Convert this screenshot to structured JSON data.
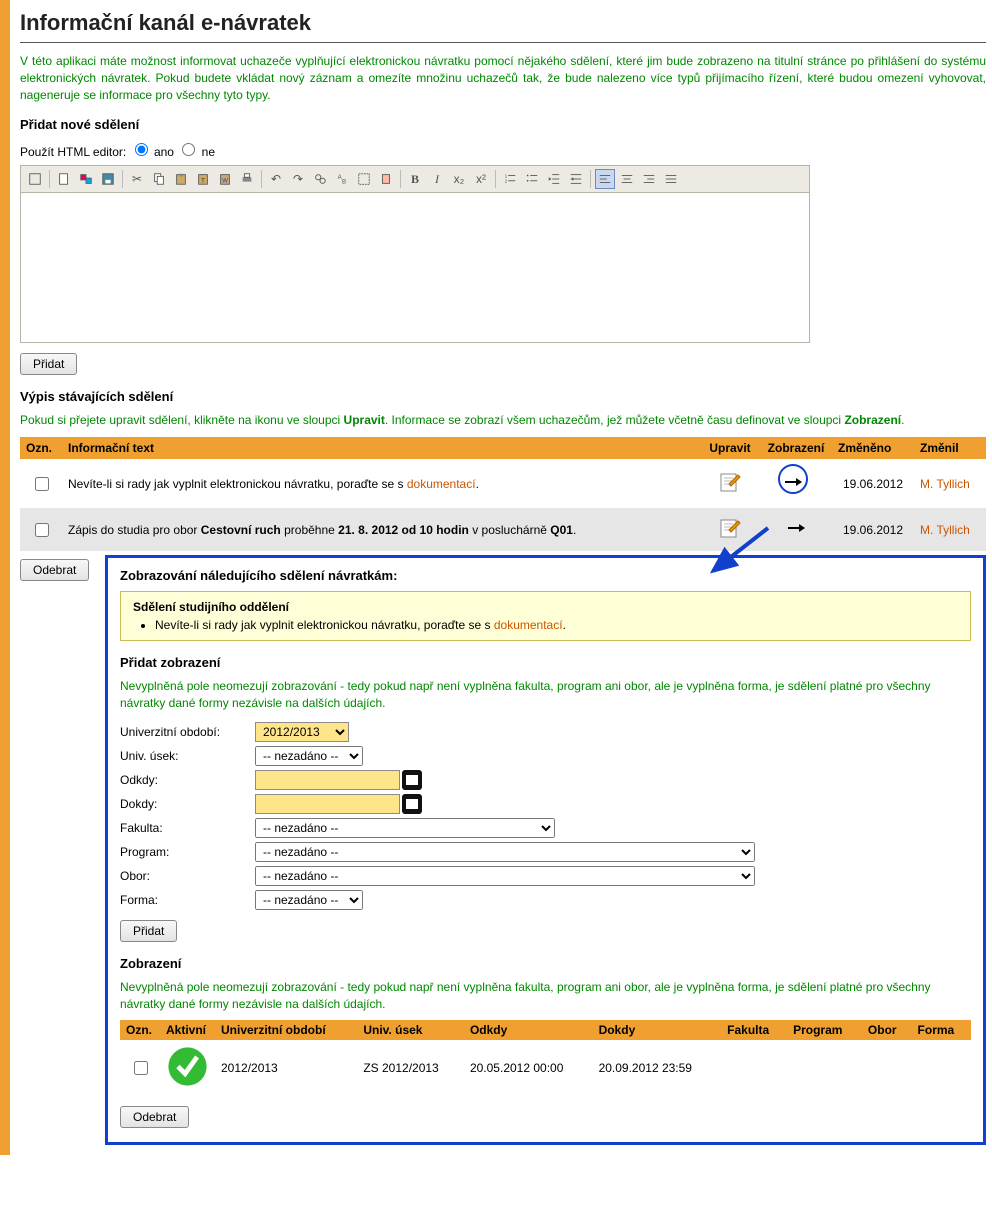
{
  "title": "Informační kanál e-návratek",
  "intro": "V této aplikaci máte možnost informovat uchazeče vyplňující elektronickou návratku pomocí nějakého sdělení, které jim bude zobrazeno na titulní stránce po přihlášení do systému elektronických návratek. Pokud budete vkládat nový záznam a omezíte množinu uchazečů tak, že bude nalezeno více typů přijímacího řízení, které budou omezení vyhovovat, nageneruje se informace pro všechny tyto typy.",
  "add_section_title": "Přidat nové sdělení",
  "editor_label": "Použít HTML editor:",
  "editor_yes": "ano",
  "editor_no": "ne",
  "add_button": "Přidat",
  "list_section_title": "Výpis stávajících sdělení",
  "list_intro_1": "Pokud si přejete upravit sdělení, klikněte na ikonu ve sloupci ",
  "list_intro_bold1": "Upravit",
  "list_intro_2": ". Informace se zobrazí všem uchazečům, jež můžete včetně času definovat ve sloupci ",
  "list_intro_bold2": "Zobrazení",
  "list_intro_3": ".",
  "cols": {
    "ozn": "Ozn.",
    "text": "Informační text",
    "edit": "Upravit",
    "view": "Zobrazení",
    "changed": "Změněno",
    "by": "Změnil"
  },
  "rows": [
    {
      "text_prefix": "Nevíte-li si rady jak vyplnit elektronickou návratku, poraďte se s ",
      "text_link": "dokumentací",
      "text_suffix": ".",
      "changed": "19.06.2012",
      "by": "M. Tyllich"
    },
    {
      "text_full": "Zápis do studia pro obor Cestovní ruch proběhne 21. 8. 2012 od 10 hodin v posluchárně Q01.",
      "text_a": "Zápis do studia pro obor ",
      "text_b": "Cestovní ruch",
      "text_c": " proběhne ",
      "text_d": "21. 8. 2012 od 10 hodin",
      "text_e": " v posluchárně ",
      "text_f": "Q01",
      "text_g": ".",
      "changed": "19.06.2012",
      "by": "M. Tyllich"
    }
  ],
  "remove_button": "Odebrat",
  "detail": {
    "heading": "Zobrazování náledujícího sdělení návratkám:",
    "msg_title": "Sdělení studijního oddělení",
    "msg_prefix": "Nevíte-li si rady jak vyplnit elektronickou návratku, poraďte se s ",
    "msg_link": "dokumentací",
    "msg_suffix": ".",
    "add_view_title": "Přidat zobrazení",
    "add_view_help": "Nevyplněná pole neomezují zobrazování - tedy pokud např není vyplněna fakulta, program ani obor, ale je vyplněna forma, je sdělení platné pro všechny návratky dané formy nezávisle na dalších údajích.",
    "form": {
      "period_label": "Univerzitní období:",
      "period_value": "2012/2013",
      "usek_label": "Univ. úsek:",
      "usek_value": "-- nezadáno --",
      "odkdy_label": "Odkdy:",
      "dokdy_label": "Dokdy:",
      "fakulta_label": "Fakulta:",
      "fakulta_value": "-- nezadáno --",
      "program_label": "Program:",
      "program_value": "-- nezadáno --",
      "obor_label": "Obor:",
      "obor_value": "-- nezadáno --",
      "forma_label": "Forma:",
      "forma_value": "-- nezadáno --"
    },
    "add_btn": "Přidat",
    "views_title": "Zobrazení",
    "views_help": "Nevyplněná pole neomezují zobrazování - tedy pokud např není vyplněna fakulta, program ani obor, ale je vyplněna forma, je sdělení platné pro všechny návratky dané formy nezávisle na dalších údajích.",
    "vcols": {
      "ozn": "Ozn.",
      "aktivni": "Aktivní",
      "period": "Univerzitní období",
      "usek": "Univ. úsek",
      "odkdy": "Odkdy",
      "dokdy": "Dokdy",
      "fakulta": "Fakulta",
      "program": "Program",
      "obor": "Obor",
      "forma": "Forma"
    },
    "vrow": {
      "period": "2012/2013",
      "usek": "ZS 2012/2013",
      "odkdy": "20.05.2012 00:00",
      "dokdy": "20.09.2012 23:59"
    },
    "remove_btn": "Odebrat"
  }
}
